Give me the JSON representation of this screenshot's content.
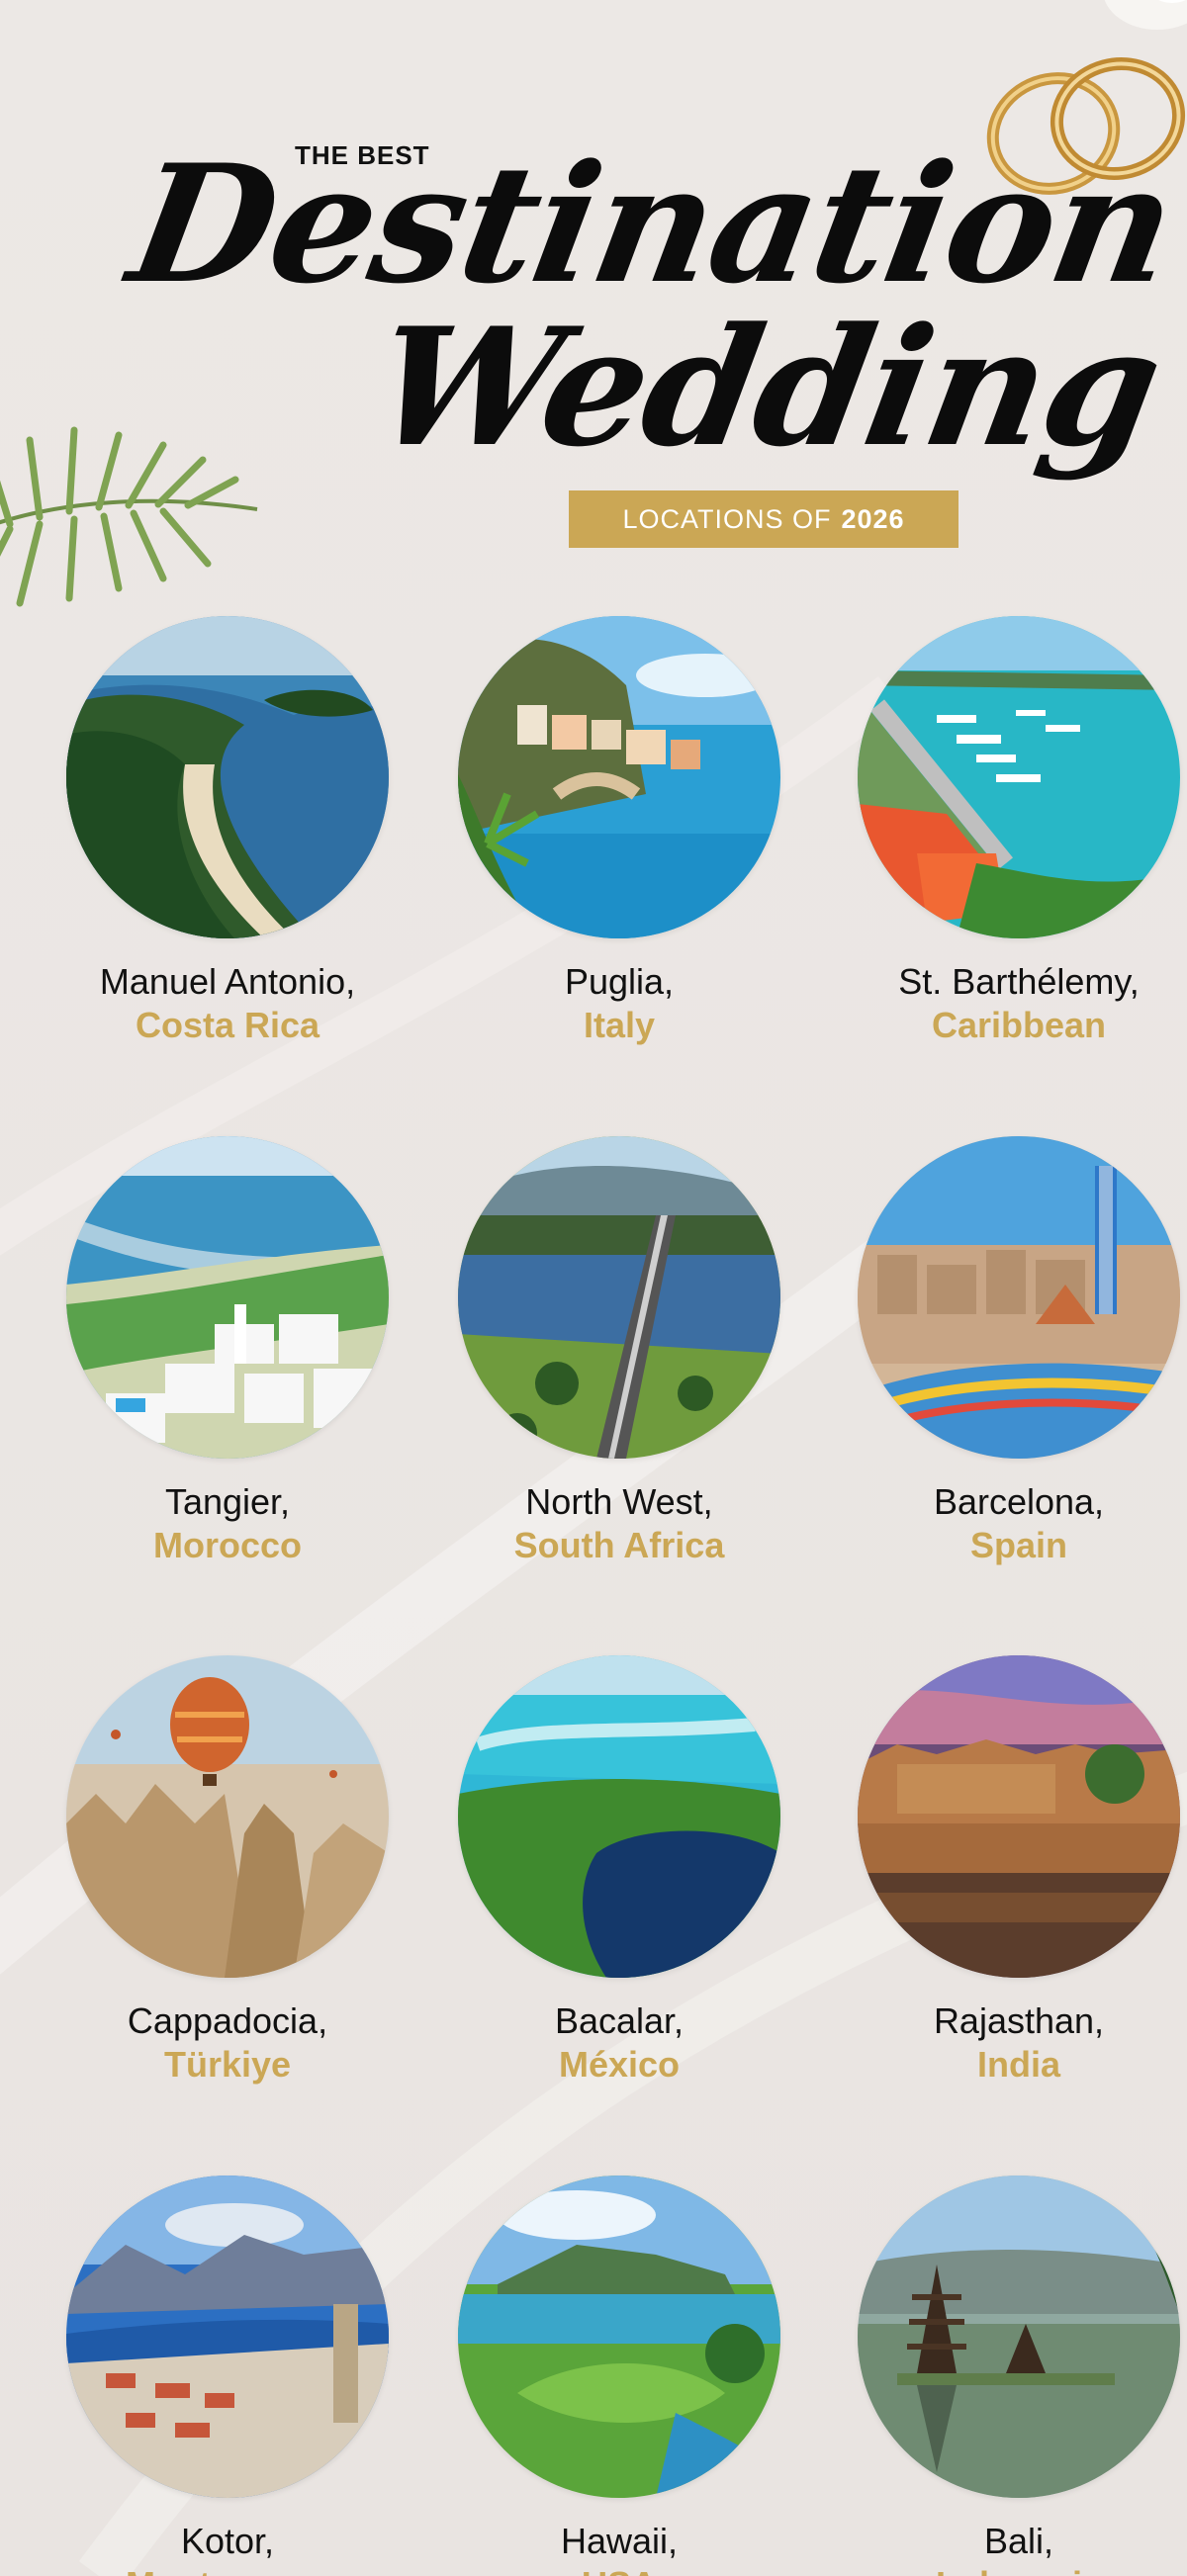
{
  "header": {
    "kicker": "THE BEST",
    "title_line1": "Destination",
    "title_line2": "Wedding",
    "subtitle_prefix": "LOCATIONS OF",
    "subtitle_year": "2026"
  },
  "colors": {
    "background": "#ece8e5",
    "gold": "#cba755",
    "text": "#111111"
  },
  "decor": {
    "rings": "gold-wedding-rings-icon",
    "palm": "palm-leaf-icon",
    "flower": "flower-icon"
  },
  "destinations": [
    {
      "city": "Manuel Antonio,",
      "country": "Costa Rica",
      "scene": "coastal-peninsula-beach"
    },
    {
      "city": "Puglia,",
      "country": "Italy",
      "scene": "cliffside-coastal-village"
    },
    {
      "city": "St. Barthélemy,",
      "country": "Caribbean",
      "scene": "harbor-with-yachts"
    },
    {
      "city": "Tangier,",
      "country": "Morocco",
      "scene": "white-city-by-the-sea"
    },
    {
      "city": "North West,",
      "country": "South Africa",
      "scene": "bridge-over-lake"
    },
    {
      "city": "Barcelona,",
      "country": "Spain",
      "scene": "mosaic-park-and-city"
    },
    {
      "city": "Cappadocia,",
      "country": "Türkiye",
      "scene": "hot-air-balloon-over-rocks"
    },
    {
      "city": "Bacalar,",
      "country": "México",
      "scene": "turquoise-lagoon-aerial"
    },
    {
      "city": "Rajasthan,",
      "country": "India",
      "scene": "fort-palace-at-sunset"
    },
    {
      "city": "Kotor,",
      "country": "Montenegro",
      "scene": "bay-with-old-town"
    },
    {
      "city": "Hawaii,",
      "country": "USA",
      "scene": "tropical-island-lagoon"
    },
    {
      "city": "Bali,",
      "country": "Indonesia",
      "scene": "lake-temple-pagoda"
    }
  ]
}
